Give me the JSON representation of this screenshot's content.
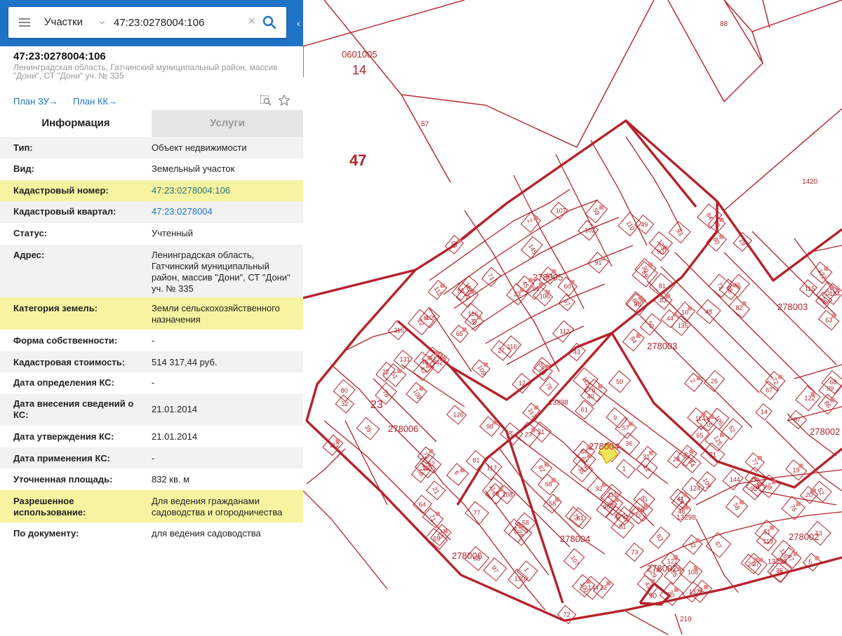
{
  "search": {
    "category": "Участки",
    "query": "47:23:0278004:106"
  },
  "object": {
    "title": "47:23:0278004:106",
    "address": "Ленинградская область, Гатчинский муниципальный район, массив \"Дони\", СТ \"Дони\" уч. № 335",
    "plan_zu": "План ЗУ→",
    "plan_kk": "План КК→"
  },
  "tabs": {
    "info": "Информация",
    "services": "Услуги"
  },
  "properties": [
    {
      "key": "Тип:",
      "value": "Объект недвижимости"
    },
    {
      "key": "Вид:",
      "value": "Земельный участок"
    },
    {
      "key": "Кадастровый номер:",
      "value": "47:23:0278004:106"
    },
    {
      "key": "Кадастровый квартал:",
      "value": "47:23:0278004"
    },
    {
      "key": "Статус:",
      "value": "Учтенный"
    },
    {
      "key": "Адрес:",
      "value": "Ленинградская область, Гатчинский муниципальный район, массив \"Дони\", СТ \"Дони\" уч. № 335"
    },
    {
      "key": "Категория земель:",
      "value": "Земли сельскохозяйственного назначения"
    },
    {
      "key": "Форма собственности:",
      "value": "-"
    },
    {
      "key": "Кадастровая стоимость:",
      "value": "514 317,44 руб."
    },
    {
      "key": "Дата определения КС:",
      "value": "-"
    },
    {
      "key": "Дата внесения сведений о КС:",
      "value": "21.01.2014"
    },
    {
      "key": "Дата утверждения КС:",
      "value": "21.01.2014"
    },
    {
      "key": "Дата применения КС:",
      "value": "-"
    },
    {
      "key": "Уточненная площадь:",
      "value": "832 кв. м"
    },
    {
      "key": "Разрешенное использование:",
      "value": "Для ведения гражданами садоводства и огородничества"
    },
    {
      "key": "По документу:",
      "value": "для ведения садоводства"
    }
  ],
  "map": {
    "line_color": "#b4232b",
    "highlight_color": "#f3e35a",
    "labels": {
      "q0601005": "0601005",
      "n14": "14",
      "n47": "47",
      "n87": "87",
      "n88": "88",
      "n1420": "1420",
      "n23": "23",
      "q278005": "278005",
      "q278003a": "278003",
      "q278003b": "278003",
      "q278006a": "278006",
      "q278006b": "278006",
      "q278004a": "278004",
      "q278004b": "278004",
      "q278002a": "278002",
      "q278002b": "278002",
      "q278002c": "278002",
      "n13298a": "13298",
      "n13298b": "13298",
      "n13298c": "13298",
      "n210": "210",
      "n90": "90"
    },
    "parcel_numbers": [
      "91",
      "92",
      "93",
      "100",
      "116",
      "95",
      "96",
      "97",
      "98",
      "12",
      "10",
      "19",
      "30",
      "36",
      "38",
      "42",
      "43",
      "44",
      "24",
      "25",
      "26",
      "1",
      "2",
      "56",
      "60",
      "61",
      "64",
      "67",
      "71",
      "115",
      "68",
      "69",
      "73",
      "72",
      "145",
      "144",
      "96",
      "99",
      "97",
      "15",
      "9",
      "10",
      "11",
      "22",
      "20",
      "107",
      "81",
      "85",
      "82",
      "83",
      "51",
      "55",
      "57",
      "58",
      "60",
      "21",
      "27",
      "26",
      "104",
      "48",
      "38",
      "52",
      "50",
      "111",
      "113",
      "115",
      "116",
      "36",
      "117",
      "32",
      "65",
      "66",
      "69",
      "68",
      "73",
      "67",
      "76",
      "77",
      "78",
      "81",
      "82",
      "122",
      "83",
      "84",
      "86",
      "87",
      "89",
      "88",
      "90",
      "91",
      "106",
      "108",
      "107",
      "128",
      "127",
      "23",
      "99",
      "29",
      "28",
      "32",
      "108",
      "109",
      "80",
      "81",
      "135",
      "52",
      "124",
      "131",
      "122",
      "132",
      "51",
      "59",
      "58",
      "61",
      "125",
      "130",
      "112",
      "65",
      "64",
      "68",
      "67",
      "123",
      "110",
      "111",
      "126",
      "73",
      "76",
      "78",
      "77",
      "94",
      "47",
      "35",
      "46",
      "48",
      "45",
      "49",
      "50",
      "63",
      "62",
      "102",
      "105",
      "30",
      "39",
      "40",
      "115",
      "116",
      "114",
      "117",
      "44",
      "43",
      "52",
      "59",
      "75",
      "57",
      "58",
      "56",
      "73",
      "72",
      "83",
      "84",
      "85",
      "71",
      "70",
      "1",
      "9",
      "19",
      "23",
      "24",
      "107",
      "6",
      "5",
      "14",
      "12",
      "13",
      "108",
      "2",
      "109",
      "110",
      "112",
      "22",
      "31",
      "32",
      "38",
      "37",
      "36",
      "26",
      "41",
      "43",
      "44",
      "45",
      "144",
      "42",
      "46",
      "93",
      "92",
      "115",
      "112",
      "71",
      "105",
      "80",
      "21"
    ]
  }
}
